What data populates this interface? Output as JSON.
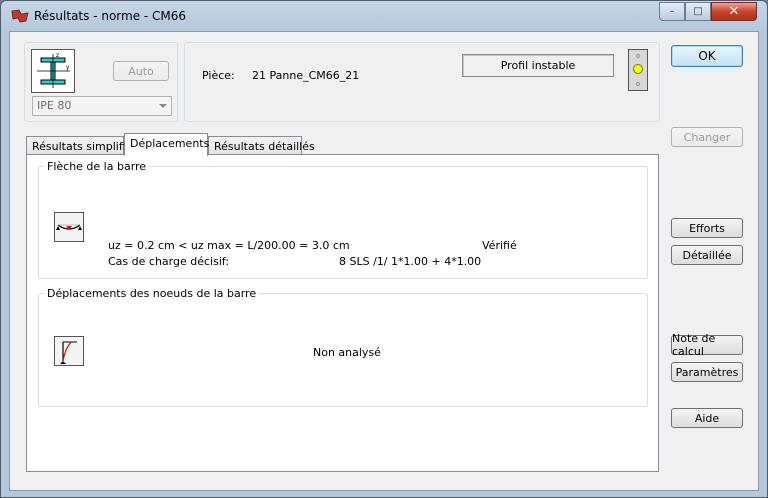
{
  "window": {
    "title": "Résultats - norme - CM66",
    "min_glyph": "–",
    "max_glyph": "□",
    "close_glyph": "✕"
  },
  "header": {
    "auto_button": "Auto",
    "profile_select": "IPE 80",
    "piece_label": "Pièce:",
    "piece_value": "21  Panne_CM66_21",
    "status": "Profil instable",
    "status_color": "#ffff00",
    "profile_axis_z": "z",
    "profile_axis_y": "y"
  },
  "tabs": [
    {
      "label": "Résultats simplifiés"
    },
    {
      "label": "Déplacements"
    },
    {
      "label": "Résultats détaillés"
    }
  ],
  "fleche": {
    "title": "Flèche de la barre",
    "line1": "uz = 0.2 cm  < uz max = L/200.00 = 3.0 cm",
    "verdict": "Vérifié",
    "load_case_label": "Cas de charge décisif:",
    "load_case_value": "8 SLS /1/  1*1.00 + 4*1.00"
  },
  "noeuds": {
    "title": "Déplacements des noeuds de la barre",
    "status": "Non analysé"
  },
  "buttons": {
    "ok": "OK",
    "changer": "Changer",
    "efforts": "Efforts",
    "detaillee": "Détaillée",
    "note": "Note de calcul",
    "parametres": "Paramètres",
    "aide": "Aide"
  }
}
